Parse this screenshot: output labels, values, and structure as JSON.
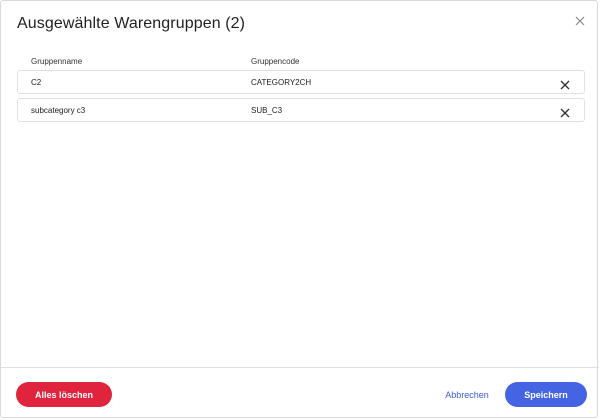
{
  "dialog": {
    "title": "Ausgewählte Warengruppen (2)",
    "close_icon": "close-icon"
  },
  "table": {
    "columns": [
      "Gruppenname",
      "Gruppencode"
    ],
    "rows": [
      {
        "name": "C2",
        "code": "CATEGORY2CH"
      },
      {
        "name": "subcategory c3",
        "code": "SUB_C3"
      }
    ],
    "remove_icon": "close-icon"
  },
  "footer": {
    "clear_all_label": "Alles löschen",
    "cancel_label": "Abbrechen",
    "save_label": "Speichern"
  },
  "colors": {
    "danger": "#e0243d",
    "primary": "#4564e3",
    "link": "#3f5bd9"
  }
}
